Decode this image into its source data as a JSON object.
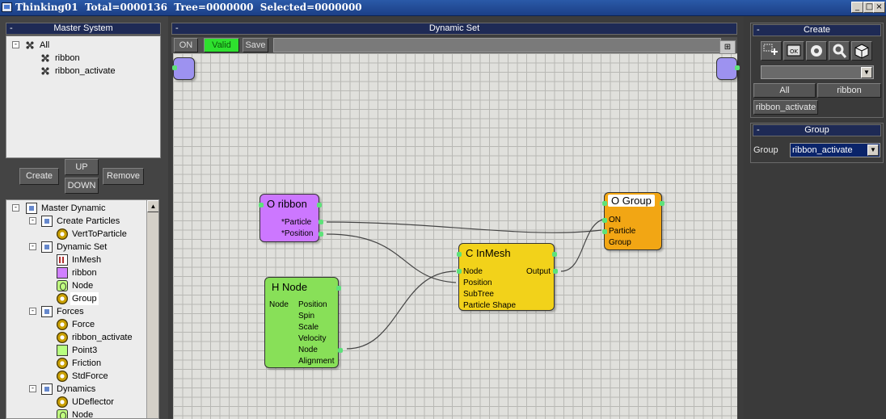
{
  "window": {
    "title": "Thinking01  Total=0000136  Tree=0000000  Selected=0000000",
    "minimize_glyph": "_",
    "maximize_glyph": "□",
    "close_glyph": "×"
  },
  "master_system": {
    "header": "Master System",
    "collapse_glyph": "-",
    "items": [
      {
        "label": "All",
        "icon": "dots-icon"
      },
      {
        "label": "ribbon",
        "icon": "dots-icon"
      },
      {
        "label": "ribbon_activate",
        "icon": "dots-icon"
      }
    ]
  },
  "mid_buttons": {
    "create": "Create",
    "up": "UP",
    "down": "DOWN",
    "remove": "Remove"
  },
  "master_dynamic": {
    "items": [
      {
        "label": "Master Dynamic",
        "icon": "doc-icon"
      },
      {
        "label": "Create Particles",
        "icon": "doc-icon"
      },
      {
        "label": "VertToParticle",
        "icon": "gear-icon"
      },
      {
        "label": "Dynamic Set",
        "icon": "doc-icon"
      },
      {
        "label": "InMesh",
        "icon": "inmesh-icon"
      },
      {
        "label": "ribbon",
        "icon": "ribbon-icon"
      },
      {
        "label": "Node",
        "icon": "node-icon"
      },
      {
        "label": "Group",
        "icon": "gear-icon",
        "selected": true
      },
      {
        "label": "Forces",
        "icon": "doc-icon"
      },
      {
        "label": "Force",
        "icon": "gear-icon"
      },
      {
        "label": "ribbon_activate",
        "icon": "gear-icon"
      },
      {
        "label": "Point3",
        "icon": "point3-icon"
      },
      {
        "label": "Friction",
        "icon": "gear-icon"
      },
      {
        "label": "StdForce",
        "icon": "gear-icon"
      },
      {
        "label": "Dynamics",
        "icon": "doc-icon"
      },
      {
        "label": "UDeflector",
        "icon": "gear-icon"
      },
      {
        "label": "Node",
        "icon": "node-icon"
      }
    ],
    "expander_glyph": "-"
  },
  "dynamic_set": {
    "header": "Dynamic Set",
    "collapse_glyph": "-",
    "toolbar": {
      "on": "ON",
      "valid": "Valid",
      "save": "Save"
    },
    "corner_glyph": "⊞"
  },
  "nodes": {
    "ribbon": {
      "title": "O ribbon",
      "ports": [
        "*Particle",
        "*Position"
      ],
      "color": "#cc77ff"
    },
    "hnode": {
      "title": "H Node",
      "left_port": "Node",
      "ports": [
        "Position",
        "Spin",
        "Scale",
        "Velocity",
        "Node",
        "Alignment"
      ],
      "color": "#88e058"
    },
    "inmesh": {
      "title": "C InMesh",
      "inputs": [
        "Node",
        "Position",
        "SubTree",
        "Particle Shape"
      ],
      "output": "Output",
      "color": "#f2d21a"
    },
    "group": {
      "title": "O Group",
      "ports": [
        "ON",
        "Particle",
        "Group"
      ],
      "color": "#f2a614"
    }
  },
  "right_panel": {
    "create_header": "Create",
    "collapse_glyph": "-",
    "icons": [
      "add-node-icon",
      "ok-icon",
      "gear-icon",
      "wrench-icon",
      "cube-icon"
    ],
    "dropdown_value": "",
    "all_label": "All",
    "ribbon_label": "ribbon",
    "ribbon_activate_label": "ribbon_activate",
    "group_header": "Group",
    "group_label": "Group",
    "group_value": "ribbon_activate",
    "dd_glyph": "▼"
  },
  "colors": {
    "accent": "#1e2a55",
    "valid": "#2ee02e",
    "knob": "#5de27a"
  }
}
